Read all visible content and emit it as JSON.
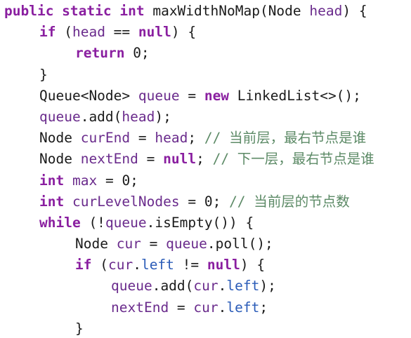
{
  "lines": [
    {
      "indent": 0,
      "tokens": [
        {
          "t": "public static int",
          "c": "kw"
        },
        {
          "t": " maxWidthNoMap(Node ",
          "c": "plain"
        },
        {
          "t": "head",
          "c": "var"
        },
        {
          "t": ") {",
          "c": "plain"
        }
      ]
    },
    {
      "indent": 1,
      "tokens": [
        {
          "t": "if",
          "c": "kw"
        },
        {
          "t": " (",
          "c": "plain"
        },
        {
          "t": "head",
          "c": "var"
        },
        {
          "t": " == ",
          "c": "plain"
        },
        {
          "t": "null",
          "c": "kw"
        },
        {
          "t": ") {",
          "c": "plain"
        }
      ]
    },
    {
      "indent": 2,
      "tokens": [
        {
          "t": "return",
          "c": "kw"
        },
        {
          "t": " 0;",
          "c": "plain"
        }
      ]
    },
    {
      "indent": 1,
      "tokens": [
        {
          "t": "}",
          "c": "plain"
        }
      ]
    },
    {
      "indent": 1,
      "tokens": [
        {
          "t": "Queue<Node> ",
          "c": "plain"
        },
        {
          "t": "queue",
          "c": "var"
        },
        {
          "t": " = ",
          "c": "plain"
        },
        {
          "t": "new",
          "c": "kw"
        },
        {
          "t": " LinkedList<>();",
          "c": "plain"
        }
      ]
    },
    {
      "indent": 1,
      "tokens": [
        {
          "t": "queue",
          "c": "var"
        },
        {
          "t": ".add(",
          "c": "plain"
        },
        {
          "t": "head",
          "c": "var"
        },
        {
          "t": ");",
          "c": "plain"
        }
      ]
    },
    {
      "indent": 1,
      "tokens": [
        {
          "t": "Node ",
          "c": "plain"
        },
        {
          "t": "curEnd",
          "c": "var"
        },
        {
          "t": " = ",
          "c": "plain"
        },
        {
          "t": "head",
          "c": "var"
        },
        {
          "t": "; ",
          "c": "plain"
        },
        {
          "t": "// 当前层，最右节点是谁",
          "c": "cmt"
        }
      ]
    },
    {
      "indent": 1,
      "tokens": [
        {
          "t": "Node ",
          "c": "plain"
        },
        {
          "t": "nextEnd",
          "c": "var"
        },
        {
          "t": " = ",
          "c": "plain"
        },
        {
          "t": "null",
          "c": "kw"
        },
        {
          "t": "; ",
          "c": "plain"
        },
        {
          "t": "// 下一层，最右节点是谁",
          "c": "cmt"
        }
      ]
    },
    {
      "indent": 1,
      "tokens": [
        {
          "t": "int",
          "c": "kw"
        },
        {
          "t": " ",
          "c": "plain"
        },
        {
          "t": "max",
          "c": "var"
        },
        {
          "t": " = 0;",
          "c": "plain"
        }
      ]
    },
    {
      "indent": 1,
      "tokens": [
        {
          "t": "int",
          "c": "kw"
        },
        {
          "t": " ",
          "c": "plain"
        },
        {
          "t": "curLevelNodes",
          "c": "var"
        },
        {
          "t": " = 0; ",
          "c": "plain"
        },
        {
          "t": "// 当前层的节点数",
          "c": "cmt"
        }
      ]
    },
    {
      "indent": 1,
      "tokens": [
        {
          "t": "while",
          "c": "kw"
        },
        {
          "t": " (!",
          "c": "plain"
        },
        {
          "t": "queue",
          "c": "var"
        },
        {
          "t": ".isEmpty()) {",
          "c": "plain"
        }
      ]
    },
    {
      "indent": 2,
      "tokens": [
        {
          "t": "Node ",
          "c": "plain"
        },
        {
          "t": "cur",
          "c": "var"
        },
        {
          "t": " = ",
          "c": "plain"
        },
        {
          "t": "queue",
          "c": "var"
        },
        {
          "t": ".poll();",
          "c": "plain"
        }
      ]
    },
    {
      "indent": 2,
      "tokens": [
        {
          "t": "if",
          "c": "kw"
        },
        {
          "t": " (",
          "c": "plain"
        },
        {
          "t": "cur",
          "c": "var"
        },
        {
          "t": ".",
          "c": "plain"
        },
        {
          "t": "left",
          "c": "fld"
        },
        {
          "t": " != ",
          "c": "plain"
        },
        {
          "t": "null",
          "c": "kw"
        },
        {
          "t": ") {",
          "c": "plain"
        }
      ]
    },
    {
      "indent": 3,
      "tokens": [
        {
          "t": "queue",
          "c": "var"
        },
        {
          "t": ".add(",
          "c": "plain"
        },
        {
          "t": "cur",
          "c": "var"
        },
        {
          "t": ".",
          "c": "plain"
        },
        {
          "t": "left",
          "c": "fld"
        },
        {
          "t": ");",
          "c": "plain"
        }
      ]
    },
    {
      "indent": 3,
      "tokens": [
        {
          "t": "nextEnd",
          "c": "var"
        },
        {
          "t": " = ",
          "c": "plain"
        },
        {
          "t": "cur",
          "c": "var"
        },
        {
          "t": ".",
          "c": "plain"
        },
        {
          "t": "left",
          "c": "fld"
        },
        {
          "t": ";",
          "c": "plain"
        }
      ]
    },
    {
      "indent": 2,
      "tokens": [
        {
          "t": "}",
          "c": "plain"
        }
      ]
    }
  ]
}
